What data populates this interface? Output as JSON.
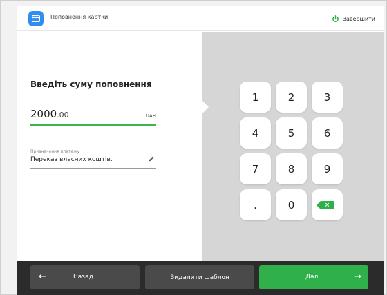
{
  "header": {
    "title": "Поповнення картки",
    "finish_label": "Завершити",
    "accent_color": "#2f8ef0",
    "finish_icon_color": "#2fb04a"
  },
  "form": {
    "prompt": "Введіть суму поповнення",
    "amount_integer": "2000",
    "amount_decimal": ".00",
    "currency": "UAH",
    "purpose_label": "Призначення платежу",
    "purpose_value": "Переказ власних коштів."
  },
  "keypad": {
    "keys": [
      "1",
      "2",
      "3",
      "4",
      "5",
      "6",
      "7",
      "8",
      "9",
      ".",
      "0"
    ],
    "backspace_icon": "backspace-icon",
    "backspace_color": "#2fb04a"
  },
  "footer": {
    "back_label": "Назад",
    "back_arrow": "←",
    "delete_label": "Видалити шаблон",
    "next_label": "Далі",
    "next_arrow": "→",
    "next_color": "#2fb04a"
  }
}
